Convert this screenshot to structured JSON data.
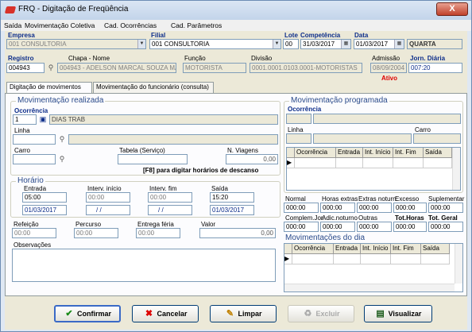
{
  "window": {
    "title": "FRQ - Digitação de Freqüência",
    "close": "X"
  },
  "menu": [
    "Saída",
    "Movimentação Coletiva",
    "Cad. Ocorrências",
    "Cad. Parâmetros"
  ],
  "header": {
    "empresa_label": "Empresa",
    "empresa_value": "001 CONSULTORIA",
    "filial_label": "Filial",
    "filial_value": "001 CONSULTORIA",
    "lote_label": "Lote",
    "lote_value": "00",
    "competencia_label": "Competência",
    "competencia_value": "31/03/2017",
    "data_label": "Data",
    "data_value": "01/03/2017",
    "weekday": "QUARTA",
    "registro_label": "Registro",
    "registro_value": "004943",
    "chapa_label": "Chapa - Nome",
    "chapa_value": "004943 - ADELSON MARCAL SOUZA MA",
    "funcao_label": "Função",
    "funcao_value": "MOTORISTA",
    "divisao_label": "Divisão",
    "divisao_value": "0001.0001.0103.0001-MOTORISTAS",
    "admissao_label": "Admissão",
    "admissao_value": "08/09/2004",
    "jornada_label": "Jorn. Diária",
    "jornada_value": "007:20",
    "status": "Ativo"
  },
  "tabs": [
    "Digitação de movimentos",
    "Movimentação do funcionário (consulta)"
  ],
  "realizada": {
    "title": "Movimentação realizada",
    "ocorrencia_label": "Ocorrência",
    "ocorrencia_code": "1",
    "ocorrencia_desc": "DIAS TRAB",
    "linha_label": "Linha",
    "carro_label": "Carro",
    "tabela_label": "Tabela (Serviço)",
    "viagens_label": "N. Viagens",
    "viagens_value": "0,00",
    "f8_hint": "[F8] para digitar horários de descanso"
  },
  "horario": {
    "title": "Horário",
    "entrada_label": "Entrada",
    "entrada_value": "05:00",
    "entrada_date": "01/03/2017",
    "ini_label": "Interv. início",
    "ini_value": "00:00",
    "ini_date": "/ /",
    "fim_label": "Interv. fim",
    "fim_value": "00:00",
    "fim_date": "/ /",
    "saida_label": "Saída",
    "saida_value": "15:20",
    "saida_date": "01/03/2017"
  },
  "extras": {
    "refeicao_label": "Refeição",
    "refeicao_value": "00:00",
    "percurso_label": "Percurso",
    "percurso_value": "00:00",
    "entrega_label": "Entrega féria",
    "entrega_value": "00:00",
    "valor_label": "Valor",
    "valor_value": "0,00",
    "obs_label": "Observações"
  },
  "programada": {
    "title": "Movimentação programada",
    "ocorrencia_label": "Ocorrência",
    "linha_label": "Linha",
    "carro_label": "Carro",
    "columns": [
      "Ocorrência",
      "Entrada",
      "Int. Início",
      "Int. Fim",
      "Saída"
    ]
  },
  "totais": {
    "labels1": [
      "Normal",
      "Horas extras",
      "Extras noturn.",
      "Excesso",
      "Suplementar"
    ],
    "values1": [
      "000:00",
      "000:00",
      "000:00",
      "000:00",
      "000:00"
    ],
    "labels2": [
      "Complem.Jor.",
      "Adic.noturno",
      "Outras",
      "Tot.Horas",
      "Tot. Geral"
    ],
    "values2": [
      "000:00",
      "000:00",
      "000:00",
      "000:00",
      "000:00"
    ]
  },
  "dia": {
    "title": "Movimentações do dia",
    "columns": [
      "Ocorrência",
      "Entrada",
      "Int. Início",
      "Int. Fim",
      "Saída"
    ]
  },
  "buttons": {
    "confirmar": "Confirmar",
    "cancelar": "Cancelar",
    "limpar": "Limpar",
    "excluir": "Excluir",
    "visualizar": "Visualizar"
  }
}
